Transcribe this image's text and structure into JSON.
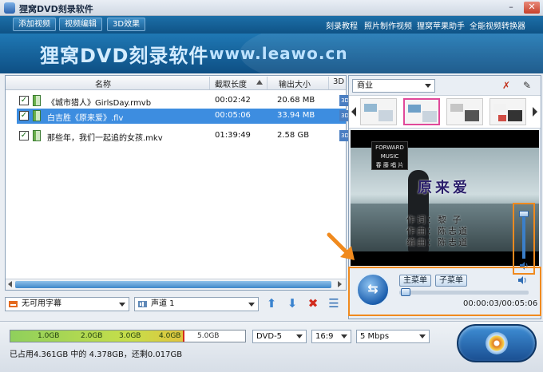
{
  "window": {
    "title": "狸窝DVD刻录软件",
    "minimize_glyph": "–",
    "close_glyph": "✕"
  },
  "toolbar": {
    "add_video": "添加视频",
    "edit_video": "视频编辑",
    "effect_3d": "3D效果",
    "links": [
      "刻录教程",
      "照片制作视频",
      "狸窝苹果助手",
      "全能视频转换器"
    ]
  },
  "banner": {
    "title": "狸窝DVD刻录软件",
    "url": "www.leawo.cn"
  },
  "file_list": {
    "columns": [
      "名称",
      "截取长度",
      "输出大小",
      "3D"
    ],
    "rows": [
      {
        "checked": true,
        "name": "《城市猎人》GirlsDay.rmvb",
        "duration": "00:02:42",
        "size": "20.68 MB",
        "badge": "3D",
        "selected": false
      },
      {
        "checked": true,
        "name": "白吉胜《原来爱》.flv",
        "duration": "00:05:06",
        "size": "33.94 MB",
        "badge": "3D",
        "selected": true
      },
      {
        "checked": true,
        "name": "那些年，我们一起追的女孩.mkv",
        "duration": "01:39:49",
        "size": "2.58 GB",
        "badge": "3D",
        "selected": false
      }
    ]
  },
  "subtitle": {
    "value": "无可用字幕"
  },
  "audio_track": {
    "value": "声道 1"
  },
  "menu_template": {
    "value": "商业"
  },
  "video_overlay": {
    "logo_lines": [
      "FORWARD",
      "MUSIC",
      "春 藤 唱 片"
    ],
    "song_title": "原来爱",
    "credits": [
      "作词：黎  子",
      "作曲：陈志道",
      "编曲：陈志道"
    ]
  },
  "player": {
    "main_menu": "主菜单",
    "sub_menu": "子菜单",
    "time": "00:00:03/00:05:06",
    "progress": 0.01,
    "volume": 0.9
  },
  "capacity": {
    "ticks": [
      "1.0GB",
      "2.0GB",
      "3.0GB",
      "4.0GB",
      "5.0GB"
    ],
    "used_fraction": 0.876,
    "summary": "已占用4.361GB 中的 4.378GB，还剩0.017GB"
  },
  "output": {
    "disc_type": "DVD-5",
    "aspect": "16:9",
    "bitrate": "5 Mbps"
  },
  "colors": {
    "accent": "#1c6fa8",
    "selection": "#3d8de0",
    "highlight": "#f08a1e"
  }
}
